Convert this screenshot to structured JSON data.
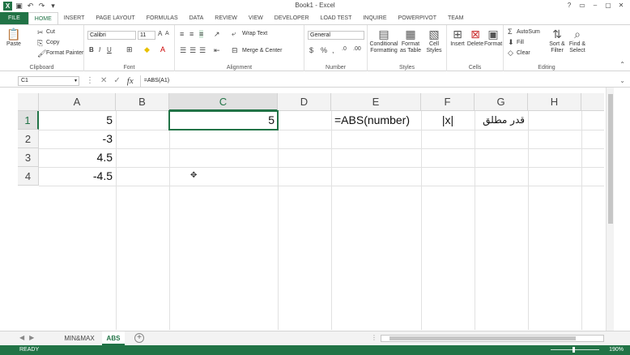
{
  "window": {
    "title": "Book1 - Excel"
  },
  "ribbon_tabs": [
    "FILE",
    "HOME",
    "INSERT",
    "PAGE LAYOUT",
    "FORMULAS",
    "DATA",
    "REVIEW",
    "VIEW",
    "DEVELOPER",
    "LOAD TEST",
    "INQUIRE",
    "POWERPIVOT",
    "TEAM"
  ],
  "ribbon": {
    "clipboard": {
      "paste": "Paste",
      "cut": "Cut",
      "copy": "Copy",
      "format_painter": "Format Painter",
      "label": "Clipboard"
    },
    "font": {
      "name": "Calibri",
      "size": "11",
      "label": "Font"
    },
    "alignment": {
      "wrap_text": "Wrap Text",
      "merge_center": "Merge & Center",
      "label": "Alignment"
    },
    "number": {
      "format": "General",
      "label": "Number"
    },
    "styles": {
      "conditional": "Conditional Formatting",
      "format_as": "Format as Table",
      "cell_styles": "Cell Styles",
      "label": "Styles"
    },
    "cells": {
      "insert": "Insert",
      "delete": "Delete",
      "format": "Format",
      "label": "Cells"
    },
    "editing": {
      "autosum": "AutoSum",
      "fill": "Fill",
      "clear": "Clear",
      "sort": "Sort & Filter",
      "find": "Find & Select",
      "label": "Editing"
    }
  },
  "formula_bar": {
    "name_box": "C1",
    "formula": "=ABS(A1)"
  },
  "grid": {
    "columns": [
      "A",
      "B",
      "C",
      "D",
      "E",
      "F",
      "G",
      "H"
    ],
    "rows": [
      "1",
      "2",
      "3",
      "4"
    ],
    "cells": {
      "A1": "5",
      "A2": "-3",
      "A3": "4.5",
      "A4": "-4.5",
      "C1": "5",
      "E1": "=ABS(number)",
      "F1": "|x|",
      "G1": "قدر مطلق"
    },
    "active_cell": "C1"
  },
  "sheets": [
    "MIN&MAX",
    "ABS"
  ],
  "active_sheet": "ABS",
  "status": {
    "ready": "READY",
    "zoom": "190%"
  },
  "colors": {
    "accent": "#217346"
  }
}
